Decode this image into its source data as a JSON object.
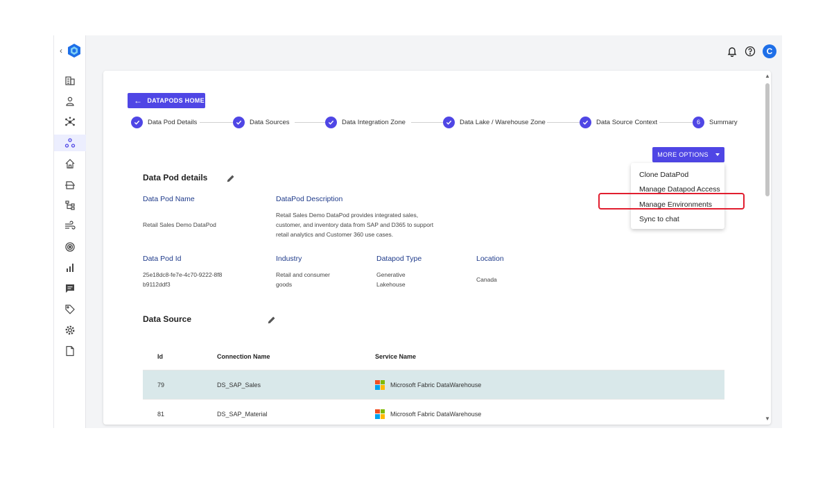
{
  "topbar": {
    "avatar_initial": "C"
  },
  "home_button": {
    "label": "DATAPODS HOME"
  },
  "steps": [
    {
      "label": "Data Pod Details"
    },
    {
      "label": "Data Sources"
    },
    {
      "label": "Data Integration Zone"
    },
    {
      "label": "Data Lake / Warehouse Zone"
    },
    {
      "label": "Data Source Context"
    },
    {
      "label": "Summary",
      "number": "6"
    }
  ],
  "more_options": {
    "label": "MORE OPTIONS",
    "items": [
      "Clone DataPod",
      "Manage Datapod Access",
      "Manage Environments",
      "Sync to chat"
    ]
  },
  "details": {
    "title": "Data Pod details",
    "name_label": "Data Pod Name",
    "name_value": "Retail Sales Demo DataPod",
    "description_label": "DataPod Description",
    "description_value": "Retail Sales Demo DataPod provides integrated sales, customer, and inventory data from SAP and D365 to support retail analytics and Customer 360 use cases.",
    "id_label": "Data Pod Id",
    "id_value": "25e18dc8-fe7e-4c70-9222-8f8b9112ddf3",
    "industry_label": "Industry",
    "industry_value": "Retail and consumer goods",
    "type_label": "Datapod Type",
    "type_value": "Generative Lakehouse",
    "location_label": "Location",
    "location_value": "Canada"
  },
  "data_source": {
    "title": "Data Source",
    "columns": [
      "Id",
      "Connection Name",
      "Service Name"
    ],
    "rows": [
      {
        "id": "79",
        "connection": "DS_SAP_Sales",
        "service": "Microsoft Fabric DataWarehouse"
      },
      {
        "id": "81",
        "connection": "DS_SAP_Material",
        "service": "Microsoft Fabric DataWarehouse"
      }
    ]
  },
  "colors": {
    "accent": "#4f46e5",
    "highlight": "#e11d2e",
    "selected_row": "#d9e8ea"
  }
}
